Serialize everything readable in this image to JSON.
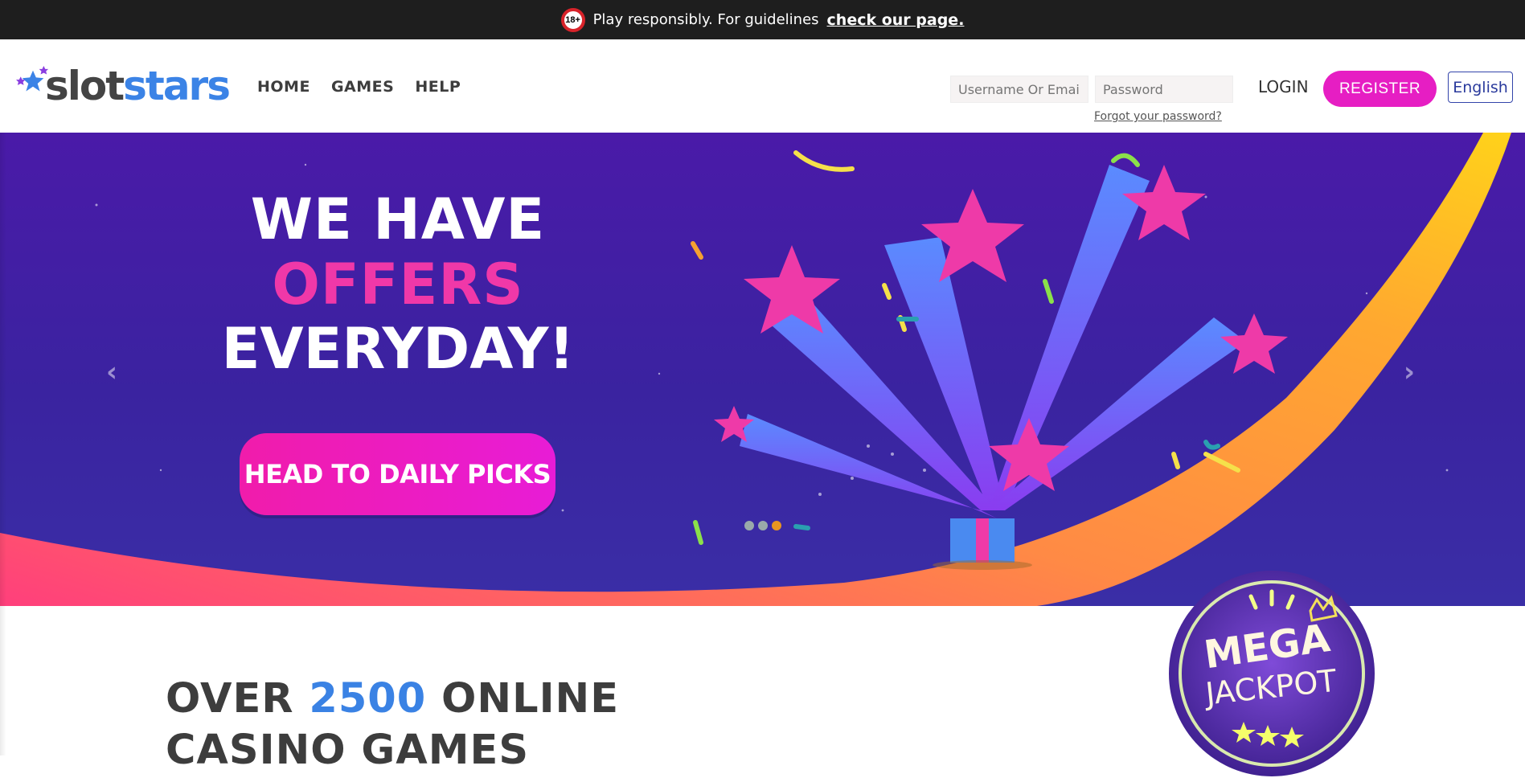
{
  "topbar": {
    "age_badge": "18+",
    "text": "Play responsibly. For guidelines",
    "link": "check our page."
  },
  "header": {
    "logo": {
      "part1": "slot",
      "part2": "stars"
    },
    "nav": [
      "HOME",
      "GAMES",
      "HELP"
    ],
    "username_placeholder": "Username Or Email",
    "password_placeholder": "Password",
    "forgot": "Forgot your password?",
    "login": "LOGIN",
    "register": "REGISTER",
    "language": "English"
  },
  "hero": {
    "line1": "WE HAVE",
    "line2": "OFFERS",
    "line3": "EVERYDAY!",
    "cta": "HEAD TO DAILY PICKS",
    "prev": "‹",
    "next": "›",
    "slides": 3,
    "active_slide": 3
  },
  "section": {
    "title_a": "OVER ",
    "title_highlight": "2500",
    "title_b": " ONLINE",
    "title_line2": "CASINO GAMES"
  },
  "jackpot": {
    "line1": "MEGA",
    "line2": "JACKPOT"
  },
  "colors": {
    "brand_pink": "#e61ec3",
    "brand_blue": "#3b83e6",
    "hero_purple": "#4a1aa8",
    "topbar": "#1e1e1e"
  }
}
